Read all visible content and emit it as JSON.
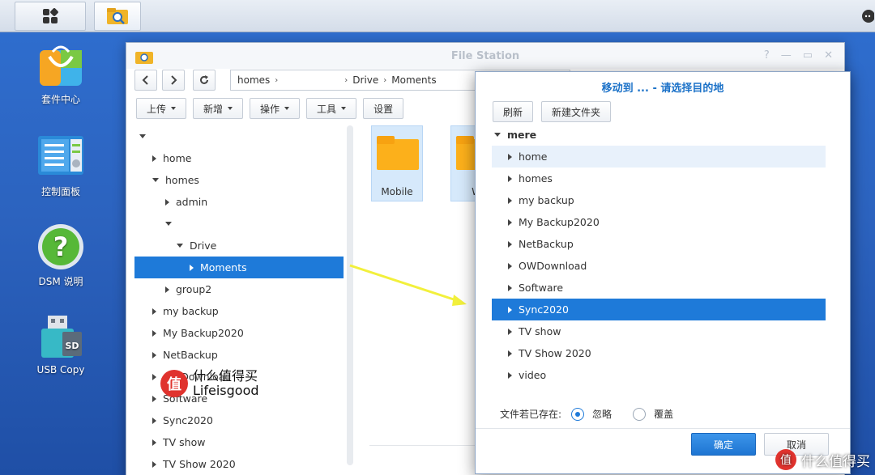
{
  "taskbar": {
    "apps_icon": "grid-icon",
    "file_station_icon": "folder-search-icon",
    "chat_icon": "chat-icon"
  },
  "desktop": {
    "icons": [
      {
        "label": "套件中心",
        "icon": "package-center-icon"
      },
      {
        "label": "控制面板",
        "icon": "control-panel-icon"
      },
      {
        "label": "DSM 说明",
        "icon": "help-icon"
      },
      {
        "label": "USB Copy",
        "icon": "usb-copy-icon"
      }
    ]
  },
  "file_station": {
    "title": "File Station",
    "path": [
      "homes",
      "",
      "Drive",
      "Moments"
    ],
    "toolbar": [
      "上传",
      "新增",
      "操作",
      "工具",
      "设置"
    ],
    "tree": [
      {
        "label": "",
        "level": 0,
        "state": "expanded"
      },
      {
        "label": "home",
        "level": 1,
        "state": "collapsed"
      },
      {
        "label": "homes",
        "level": 1,
        "state": "expanded"
      },
      {
        "label": "admin",
        "level": 2,
        "state": "collapsed"
      },
      {
        "label": "",
        "level": 2,
        "state": "expanded"
      },
      {
        "label": "Drive",
        "level": 3,
        "state": "expanded"
      },
      {
        "label": "Moments",
        "level": 4,
        "state": "collapsed",
        "selected": true
      },
      {
        "label": "group2",
        "level": 2,
        "state": "collapsed"
      },
      {
        "label": "my backup",
        "level": 1,
        "state": "collapsed"
      },
      {
        "label": "My Backup2020",
        "level": 1,
        "state": "collapsed"
      },
      {
        "label": "NetBackup",
        "level": 1,
        "state": "collapsed"
      },
      {
        "label": "OWDownload",
        "level": 1,
        "state": "collapsed"
      },
      {
        "label": "Software",
        "level": 1,
        "state": "collapsed"
      },
      {
        "label": "Sync2020",
        "level": 1,
        "state": "collapsed"
      },
      {
        "label": "TV show",
        "level": 1,
        "state": "collapsed"
      },
      {
        "label": "TV Show 2020",
        "level": 1,
        "state": "collapsed"
      }
    ],
    "folders": [
      "Mobile",
      "W"
    ]
  },
  "dialog": {
    "title": "移动到 ... - 请选择目的地",
    "refresh_label": "刷新",
    "new_folder_label": "新建文件夹",
    "root_label": "mere",
    "items": [
      {
        "label": "home",
        "state": "hover"
      },
      {
        "label": "homes"
      },
      {
        "label": "my backup"
      },
      {
        "label": "My Backup2020"
      },
      {
        "label": "NetBackup"
      },
      {
        "label": "OWDownload"
      },
      {
        "label": "Software"
      },
      {
        "label": "Sync2020",
        "state": "selected"
      },
      {
        "label": "TV show"
      },
      {
        "label": "TV Show 2020"
      },
      {
        "label": "video"
      }
    ],
    "exists_label": "文件若已存在:",
    "option_skip": "忽略",
    "option_overwrite": "覆盖",
    "selected_option": "忽略",
    "ok_label": "确定",
    "cancel_label": "取消"
  },
  "watermark": {
    "logo_char": "值",
    "line1": "什么值得买",
    "line2": "Lifeisgood",
    "corner": "什么值得买"
  },
  "colors": {
    "accent": "#1e7ad9",
    "arrow": "#f2f03c",
    "desktop": "#2c63bf"
  }
}
